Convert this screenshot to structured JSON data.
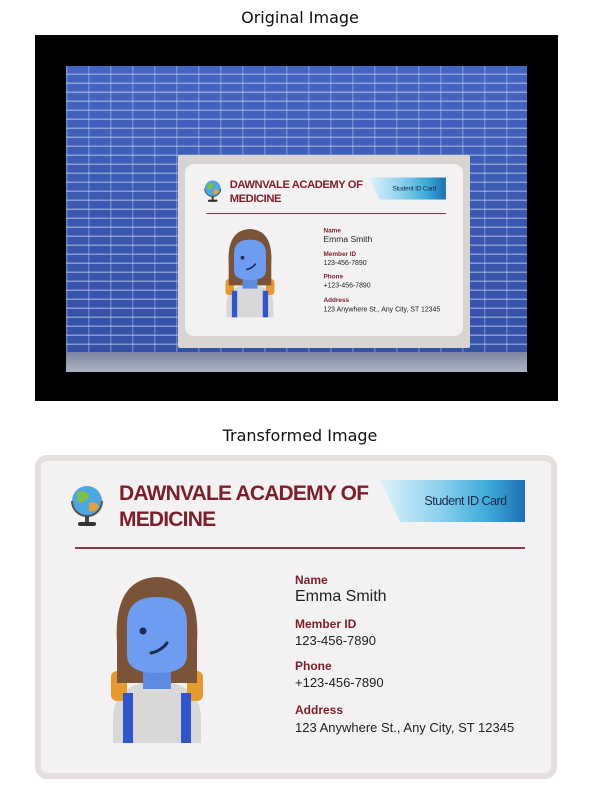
{
  "titles": {
    "original": "Original Image",
    "transformed": "Transformed Image"
  },
  "card": {
    "school_name": "DAWNVALE ACADEMY OF MEDICINE",
    "badge": "Student ID Card",
    "fields": [
      {
        "label": "Name",
        "value": "Emma Smith"
      },
      {
        "label": "Member ID",
        "value": "123-456-7890"
      },
      {
        "label": "Phone",
        "value": "+123-456-7890"
      },
      {
        "label": "Address",
        "value": "123 Anywhere St., Any City, ST 12345"
      }
    ]
  },
  "icons": {
    "logo": "globe-icon",
    "photo": "student-avatar"
  },
  "colors": {
    "accent": "#7a1f2b",
    "brick": "#3d5db6",
    "ribbon": "#3da9d8",
    "avatar_skin": "#6e9cf0",
    "avatar_hair": "#7a5338"
  }
}
